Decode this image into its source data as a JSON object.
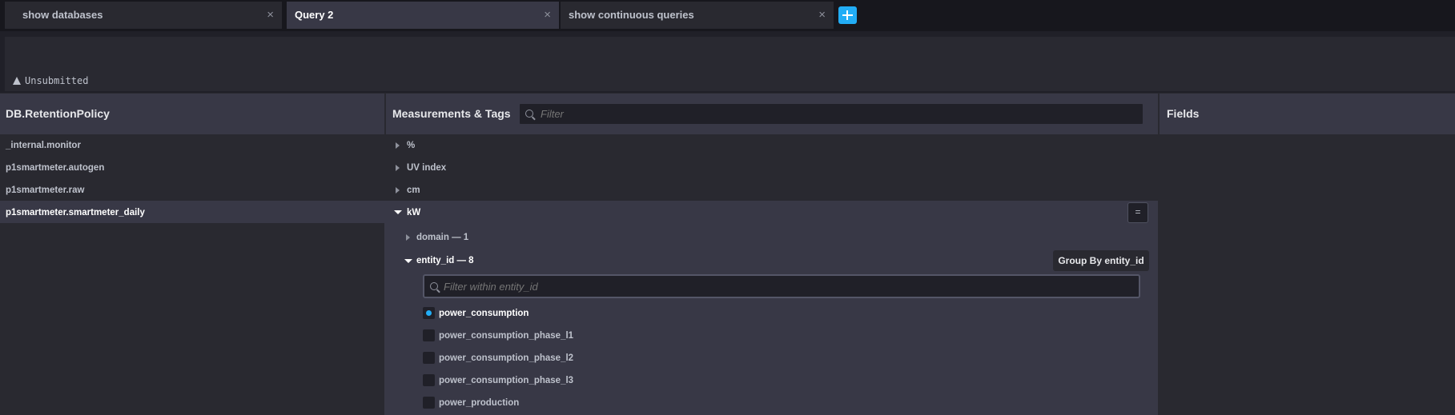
{
  "tabs": [
    {
      "label": "show databases"
    },
    {
      "label": "Query 2"
    },
    {
      "label": "show continuous queries"
    }
  ],
  "tab_close_glyph": "×",
  "editor": {
    "status": "Unsubmitted",
    "status_icon": "warning-icon"
  },
  "explorer": {
    "db_header": "DB.RetentionPolicy",
    "measurements_header": "Measurements & Tags",
    "fields_header": "Fields",
    "filter_placeholder": "Filter",
    "databases": [
      "_internal.monitor",
      "p1smartmeter.autogen",
      "p1smartmeter.raw",
      "p1smartmeter.smartmeter_daily"
    ],
    "measurements": [
      "%",
      "UV index",
      "cm",
      "kW"
    ],
    "kw_menu_glyph": "=",
    "tags": [
      "domain — 1",
      "entity_id — 8"
    ],
    "group_by": "Group By entity_id",
    "tag_filter_placeholder": "Filter within entity_id",
    "tag_values": [
      "power_consumption",
      "power_consumption_phase_l1",
      "power_consumption_phase_l2",
      "power_consumption_phase_l3",
      "power_production"
    ]
  },
  "colors": {
    "accent": "#22adf6",
    "background": "#202028",
    "panel": "#292930",
    "header": "#383846"
  }
}
